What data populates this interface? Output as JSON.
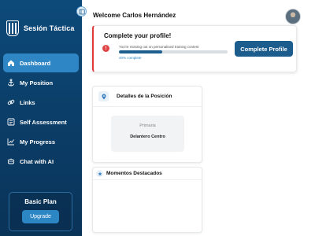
{
  "brand": {
    "name": "Sesión Táctica",
    "logo_icon": "shield-stripes-icon"
  },
  "sidebar": {
    "items": [
      {
        "label": "Dashboard",
        "icon": "home-icon",
        "active": true
      },
      {
        "label": "My Position",
        "icon": "anchor-icon",
        "active": false
      },
      {
        "label": "Links",
        "icon": "link-icon",
        "active": false
      },
      {
        "label": "Self Assessment",
        "icon": "checklist-icon",
        "active": false
      },
      {
        "label": "My Progress",
        "icon": "chart-line-icon",
        "active": false
      },
      {
        "label": "Chat with AI",
        "icon": "robot-icon",
        "active": false
      }
    ],
    "plan": {
      "title": "Basic Plan",
      "button": "Upgrade"
    }
  },
  "header": {
    "welcome": "Welcome Carlos Hernández"
  },
  "profile": {
    "title": "Complete your profile!",
    "message": "You're missing out on personalised training content",
    "progress": 40,
    "progress_label": "40% complete",
    "button": "Complete Profile"
  },
  "position_card": {
    "title": "Detalles de la Posición",
    "label": "Primaria",
    "value": "Delantero Centro"
  },
  "highlights_card": {
    "title": "Momentos Destacados"
  },
  "colors": {
    "sidebar": "#0b3f6a",
    "active_item": "#2f86c4",
    "primary_button": "#1c5d8e",
    "warning": "#e03a3a"
  }
}
